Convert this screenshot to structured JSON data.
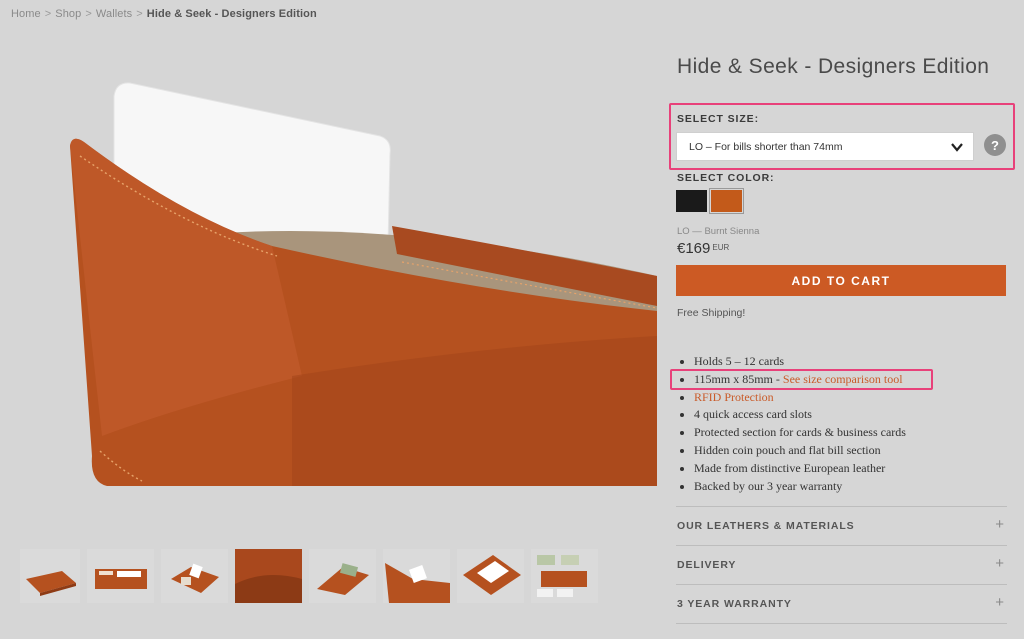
{
  "breadcrumb": {
    "items": [
      "Home",
      "Shop",
      "Wallets"
    ],
    "separator": ">",
    "current": "Hide & Seek - Designers Edition"
  },
  "product": {
    "title": "Hide & Seek - Designers Edition",
    "size_label": "SELECT SIZE:",
    "size_selected": "LO – For bills shorter than 74mm",
    "help_label": "?",
    "color_label": "SELECT COLOR:",
    "colors": [
      {
        "name": "Black",
        "hex": "#1a1a1a"
      },
      {
        "name": "Burnt Sienna",
        "hex": "#c35a1a"
      }
    ],
    "variant": "LO — Burnt Sienna",
    "price": "€169",
    "currency": "EUR",
    "add_to_cart": "ADD TO CART",
    "free_shipping": "Free Shipping!",
    "features": [
      "Holds 5 – 12 cards",
      "115mm x 85mm - ",
      "RFID Protection",
      "4 quick access card slots",
      "Protected section for cards & business cards",
      "Hidden coin pouch and flat bill section",
      "Made from distinctive European leather",
      "Backed by our 3 year warranty"
    ],
    "size_tool_link": "See size comparison tool"
  },
  "accordions": [
    {
      "label": "OUR LEATHERS & MATERIALS",
      "icon": "plus-icon"
    },
    {
      "label": "DELIVERY",
      "icon": "plus-icon"
    },
    {
      "label": "3 YEAR WARRANTY",
      "icon": "plus-icon"
    }
  ],
  "thumbnails_count": 8,
  "colors": {
    "accent": "#cc5a24",
    "highlight": "#e8417a",
    "link": "#c95b2a",
    "background": "#d6d6d6"
  }
}
